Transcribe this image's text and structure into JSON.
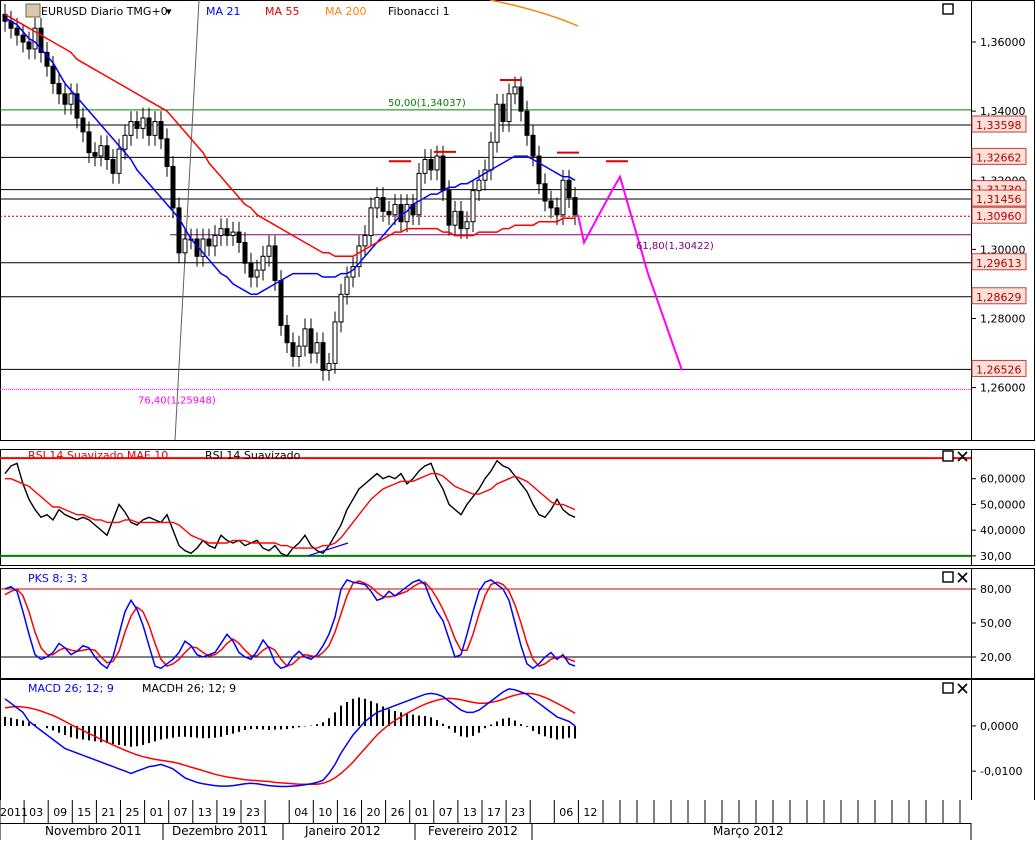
{
  "chart_data": [
    {
      "type": "candlestick",
      "panel": "price",
      "title": "EURUSD Diario TMG+0",
      "title_glyph": "▾",
      "legend": [
        {
          "label": "MA 21",
          "color": "#0000ff"
        },
        {
          "label": "MA 55",
          "color": "#ff0000"
        },
        {
          "label": "MA 200",
          "color": "#ff8000"
        },
        {
          "label": "Fibonacci 1",
          "color": "#000000"
        }
      ],
      "ylim": [
        1.246,
        1.371
      ],
      "yticks": [
        "1,36000",
        "1,34000",
        "1,32000",
        "1,30000",
        "1,28000",
        "1,26000"
      ],
      "ytick_values": [
        1.36,
        1.34,
        1.32,
        1.3,
        1.28,
        1.26
      ],
      "level_labels": [
        {
          "value": 1.33598,
          "label": "1,33598",
          "line": "#000000"
        },
        {
          "value": 1.32662,
          "label": "1,32662",
          "line": "#000000"
        },
        {
          "value": 1.3173,
          "label": "1,31730",
          "line": "#000000"
        },
        {
          "value": 1.31456,
          "label": "1,31456",
          "line": "#000000"
        },
        {
          "value": 1.3096,
          "label": "1,30960",
          "line": "#cc0000"
        },
        {
          "value": 1.29613,
          "label": "1,29613",
          "line": "#000000"
        },
        {
          "value": 1.28629,
          "label": "1,28629",
          "line": "#000000"
        },
        {
          "value": 1.26526,
          "label": "1,26526",
          "line": "#000000"
        }
      ],
      "fibonacci": [
        {
          "label": "50,00(1,34037)",
          "value": 1.34037,
          "color": "#008000"
        },
        {
          "label": "61,80(1,30422)",
          "value": 1.30422,
          "color": "#800080"
        },
        {
          "label": "76,40(1,25948)",
          "value": 1.25948,
          "color": "#ff00ff"
        }
      ],
      "closes": [
        1.366,
        1.364,
        1.362,
        1.36,
        1.358,
        1.364,
        1.357,
        1.353,
        1.348,
        1.345,
        1.342,
        1.345,
        1.338,
        1.334,
        1.328,
        1.327,
        1.33,
        1.326,
        1.322,
        1.329,
        1.333,
        1.337,
        1.335,
        1.338,
        1.333,
        1.337,
        1.332,
        1.324,
        1.312,
        1.299,
        1.303,
        1.303,
        1.298,
        1.303,
        1.301,
        1.304,
        1.306,
        1.304,
        1.305,
        1.302,
        1.296,
        1.292,
        1.294,
        1.298,
        1.301,
        1.291,
        1.278,
        1.273,
        1.269,
        1.272,
        1.277,
        1.27,
        1.273,
        1.265,
        1.267,
        1.279,
        1.287,
        1.292,
        1.295,
        1.301,
        1.304,
        1.312,
        1.315,
        1.311,
        1.31,
        1.313,
        1.308,
        1.313,
        1.31,
        1.322,
        1.326,
        1.323,
        1.327,
        1.317,
        1.307,
        1.311,
        1.306,
        1.308,
        1.317,
        1.32,
        1.323,
        1.331,
        1.342,
        1.337,
        1.345,
        1.347,
        1.34,
        1.333,
        1.327,
        1.319,
        1.314,
        1.312,
        1.31,
        1.32,
        1.315,
        1.31
      ],
      "ma21": [
        1.367,
        1.366,
        1.365,
        1.363,
        1.361,
        1.36,
        1.358,
        1.356,
        1.354,
        1.351,
        1.348,
        1.346,
        1.344,
        1.342,
        1.34,
        1.338,
        1.336,
        1.334,
        1.332,
        1.33,
        1.328,
        1.326,
        1.323,
        1.321,
        1.319,
        1.317,
        1.315,
        1.313,
        1.311,
        1.309,
        1.306,
        1.303,
        1.301,
        1.299,
        1.297,
        1.295,
        1.293,
        1.292,
        1.29,
        1.289,
        1.288,
        1.287,
        1.287,
        1.288,
        1.289,
        1.29,
        1.291,
        1.292,
        1.293,
        1.293,
        1.293,
        1.293,
        1.293,
        1.292,
        1.292,
        1.292,
        1.293,
        1.293,
        1.294,
        1.296,
        1.298,
        1.3,
        1.302,
        1.304,
        1.306,
        1.308,
        1.31,
        1.311,
        1.313,
        1.314,
        1.315,
        1.316,
        1.316,
        1.317,
        1.318,
        1.318,
        1.319,
        1.319,
        1.32,
        1.321,
        1.322,
        1.323,
        1.324,
        1.325,
        1.326,
        1.327,
        1.327,
        1.327,
        1.326,
        1.325,
        1.324,
        1.323,
        1.322,
        1.321,
        1.321,
        1.32
      ],
      "ma55": [
        1.368,
        1.367,
        1.366,
        1.365,
        1.364,
        1.363,
        1.362,
        1.361,
        1.36,
        1.359,
        1.358,
        1.357,
        1.355,
        1.354,
        1.353,
        1.352,
        1.351,
        1.35,
        1.349,
        1.348,
        1.347,
        1.346,
        1.345,
        1.344,
        1.343,
        1.342,
        1.341,
        1.34,
        1.338,
        1.336,
        1.334,
        1.332,
        1.33,
        1.328,
        1.325,
        1.323,
        1.321,
        1.319,
        1.317,
        1.315,
        1.313,
        1.312,
        1.31,
        1.309,
        1.308,
        1.307,
        1.306,
        1.305,
        1.304,
        1.303,
        1.302,
        1.301,
        1.3,
        1.299,
        1.299,
        1.298,
        1.298,
        1.298,
        1.298,
        1.299,
        1.3,
        1.301,
        1.302,
        1.303,
        1.304,
        1.305,
        1.305,
        1.306,
        1.306,
        1.306,
        1.306,
        1.306,
        1.306,
        1.305,
        1.305,
        1.304,
        1.304,
        1.304,
        1.304,
        1.305,
        1.305,
        1.305,
        1.305,
        1.306,
        1.306,
        1.307,
        1.307,
        1.307,
        1.307,
        1.308,
        1.308,
        1.308,
        1.308,
        1.309,
        1.309,
        1.309
      ],
      "projection": [
        1.31,
        1.302,
        1.317,
        1.321,
        1.293,
        1.265
      ]
    },
    {
      "type": "line",
      "panel": "rsi",
      "legend": [
        {
          "label": "RSI 14 Suavizado MAE 10",
          "color": "#ff0000"
        },
        {
          "label": "RSI 14 Suavizado",
          "color": "#000000"
        }
      ],
      "ylim": [
        28,
        70
      ],
      "yticks": [
        "60,0000",
        "50,0000",
        "40,0000",
        "30,00"
      ],
      "ytick_values": [
        60,
        50,
        40,
        30
      ],
      "levels": [
        {
          "value": 68,
          "color": "#ff0000"
        },
        {
          "value": 30,
          "color": "#008000"
        }
      ],
      "rsi": [
        62,
        65,
        66,
        58,
        52,
        48,
        45,
        46,
        44,
        48,
        46,
        45,
        44,
        45,
        44,
        42,
        40,
        38,
        44,
        50,
        47,
        43,
        42,
        44,
        45,
        44,
        43,
        46,
        40,
        34,
        32,
        31,
        33,
        36,
        34,
        33,
        38,
        36,
        35,
        36,
        34,
        35,
        36,
        33,
        32,
        34,
        31,
        30,
        33,
        35,
        38,
        34,
        32,
        31,
        34,
        38,
        42,
        48,
        52,
        56,
        58,
        60,
        62,
        60,
        61,
        60,
        62,
        58,
        60,
        63,
        65,
        66,
        60,
        56,
        50,
        48,
        46,
        50,
        53,
        56,
        60,
        63,
        67,
        65,
        64,
        61,
        58,
        55,
        50,
        46,
        45,
        48,
        52,
        48,
        46,
        45
      ],
      "rsi_ma": [
        60,
        60,
        59,
        58,
        57,
        55,
        53,
        51,
        49,
        49,
        48,
        47,
        46,
        46,
        45,
        44,
        44,
        43,
        43,
        43,
        44,
        44,
        43,
        43,
        43,
        43,
        43,
        43,
        43,
        42,
        40,
        38,
        37,
        36,
        35,
        35,
        35,
        35,
        36,
        36,
        36,
        35,
        35,
        35,
        35,
        35,
        34,
        34,
        33,
        33,
        33,
        33,
        33,
        34,
        34,
        35,
        37,
        40,
        43,
        46,
        49,
        52,
        54,
        56,
        57,
        58,
        59,
        59,
        59,
        60,
        61,
        62,
        62,
        61,
        59,
        57,
        56,
        55,
        54,
        54,
        55,
        56,
        58,
        59,
        60,
        61,
        60,
        59,
        57,
        55,
        53,
        51,
        50,
        50,
        49,
        48
      ]
    },
    {
      "type": "line",
      "panel": "stochastic",
      "legend": [
        {
          "label": "PKS 8; 3; 3",
          "color": "#0000ff"
        }
      ],
      "ylim": [
        5,
        95
      ],
      "yticks": [
        "80,00",
        "50,00",
        "20,00"
      ],
      "ytick_values": [
        80,
        50,
        20
      ],
      "levels": [
        {
          "value": 80,
          "color": "#cc0000"
        },
        {
          "value": 20,
          "color": "#000000"
        }
      ],
      "k": [
        80,
        82,
        78,
        60,
        40,
        22,
        18,
        20,
        24,
        32,
        28,
        22,
        25,
        30,
        28,
        20,
        14,
        10,
        20,
        40,
        60,
        70,
        62,
        48,
        30,
        12,
        10,
        14,
        18,
        24,
        34,
        30,
        22,
        20,
        22,
        24,
        32,
        40,
        34,
        24,
        20,
        18,
        25,
        35,
        28,
        15,
        10,
        12,
        20,
        25,
        20,
        18,
        22,
        30,
        40,
        55,
        80,
        88,
        86,
        85,
        84,
        78,
        70,
        72,
        78,
        74,
        78,
        82,
        86,
        88,
        84,
        70,
        60,
        52,
        36,
        20,
        22,
        40,
        60,
        78,
        86,
        88,
        84,
        80,
        70,
        50,
        30,
        14,
        10,
        14,
        20,
        24,
        18,
        22,
        14,
        12
      ],
      "d": [
        75,
        78,
        80,
        74,
        60,
        42,
        28,
        22,
        22,
        26,
        28,
        26,
        25,
        26,
        27,
        26,
        20,
        15,
        16,
        25,
        42,
        56,
        64,
        60,
        48,
        32,
        18,
        12,
        14,
        18,
        24,
        29,
        28,
        24,
        21,
        22,
        26,
        32,
        36,
        32,
        26,
        21,
        21,
        26,
        29,
        26,
        18,
        12,
        14,
        19,
        22,
        21,
        20,
        24,
        30,
        42,
        58,
        74,
        85,
        87,
        85,
        82,
        77,
        73,
        73,
        74,
        76,
        78,
        82,
        85,
        86,
        80,
        72,
        62,
        50,
        36,
        26,
        26,
        40,
        58,
        74,
        84,
        86,
        84,
        78,
        66,
        50,
        32,
        18,
        12,
        14,
        18,
        20,
        20,
        18,
        16
      ]
    },
    {
      "type": "line",
      "panel": "macd",
      "legend": [
        {
          "label": "MACD 26; 12; 9",
          "color": "#0000ff"
        },
        {
          "label": "MACDH 26; 12; 9",
          "color": "#000000"
        }
      ],
      "ylim": [
        -0.0155,
        0.0095
      ],
      "yticks": [
        "0,0000",
        "-0,0100"
      ],
      "ytick_values": [
        0,
        -0.01
      ],
      "macd": [
        0.006,
        0.005,
        0.004,
        0.003,
        0.001,
        0.0,
        -0.001,
        -0.002,
        -0.003,
        -0.004,
        -0.005,
        -0.0055,
        -0.006,
        -0.0065,
        -0.007,
        -0.0075,
        -0.008,
        -0.0085,
        -0.009,
        -0.0095,
        -0.01,
        -0.0105,
        -0.01,
        -0.0095,
        -0.009,
        -0.0088,
        -0.0085,
        -0.009,
        -0.0095,
        -0.0105,
        -0.0115,
        -0.012,
        -0.0125,
        -0.0128,
        -0.013,
        -0.0132,
        -0.0133,
        -0.0133,
        -0.0132,
        -0.013,
        -0.0128,
        -0.0127,
        -0.0128,
        -0.013,
        -0.0132,
        -0.0133,
        -0.0134,
        -0.0134,
        -0.0133,
        -0.0132,
        -0.013,
        -0.0128,
        -0.0125,
        -0.012,
        -0.0105,
        -0.0085,
        -0.006,
        -0.004,
        -0.002,
        -0.0005,
        0.001,
        0.002,
        0.003,
        0.0035,
        0.004,
        0.0045,
        0.005,
        0.0055,
        0.006,
        0.0065,
        0.007,
        0.0072,
        0.007,
        0.0065,
        0.0055,
        0.0045,
        0.0035,
        0.003,
        0.003,
        0.0035,
        0.0045,
        0.0055,
        0.0065,
        0.0075,
        0.0082,
        0.008,
        0.0075,
        0.007,
        0.006,
        0.005,
        0.004,
        0.003,
        0.002,
        0.0015,
        0.001,
        0.0
      ],
      "signal": [
        0.004,
        0.0042,
        0.0043,
        0.0042,
        0.004,
        0.0037,
        0.0033,
        0.0028,
        0.0023,
        0.0017,
        0.001,
        0.0003,
        -0.0004,
        -0.001,
        -0.0017,
        -0.0023,
        -0.003,
        -0.0036,
        -0.0042,
        -0.0048,
        -0.0054,
        -0.0059,
        -0.0064,
        -0.0068,
        -0.0071,
        -0.0074,
        -0.0076,
        -0.0078,
        -0.008,
        -0.0083,
        -0.0087,
        -0.0091,
        -0.0095,
        -0.0099,
        -0.0103,
        -0.0107,
        -0.011,
        -0.0113,
        -0.0115,
        -0.0117,
        -0.0119,
        -0.012,
        -0.0121,
        -0.0122,
        -0.0123,
        -0.0125,
        -0.0126,
        -0.0127,
        -0.0128,
        -0.0129,
        -0.0129,
        -0.0129,
        -0.0129,
        -0.0127,
        -0.0122,
        -0.0115,
        -0.0105,
        -0.0093,
        -0.008,
        -0.0065,
        -0.005,
        -0.0035,
        -0.002,
        -0.0008,
        0.0003,
        0.0012,
        0.002,
        0.0028,
        0.0035,
        0.0042,
        0.0048,
        0.0053,
        0.0057,
        0.006,
        0.0061,
        0.006,
        0.0058,
        0.0055,
        0.0052,
        0.005,
        0.005,
        0.0052,
        0.0055,
        0.0059,
        0.0064,
        0.0068,
        0.0071,
        0.0072,
        0.0071,
        0.0068,
        0.0063,
        0.0057,
        0.005,
        0.0043,
        0.0036,
        0.0028
      ],
      "hist": [
        0.002,
        0.0018,
        0.0015,
        0.0012,
        0.0008,
        0.0004,
        0.0,
        -0.0005,
        -0.001,
        -0.0015,
        -0.002,
        -0.0025,
        -0.0028,
        -0.003,
        -0.0032,
        -0.0034,
        -0.0036,
        -0.0038,
        -0.004,
        -0.0042,
        -0.0044,
        -0.0046,
        -0.0045,
        -0.0042,
        -0.0038,
        -0.0034,
        -0.003,
        -0.0028,
        -0.0026,
        -0.0024,
        -0.0024,
        -0.0025,
        -0.0026,
        -0.0027,
        -0.0027,
        -0.0026,
        -0.0024,
        -0.002,
        -0.0017,
        -0.0013,
        -0.0009,
        -0.0007,
        -0.0007,
        -0.0008,
        -0.0009,
        -0.0008,
        -0.0008,
        -0.0007,
        -0.0005,
        -0.0003,
        -0.0001,
        0.0001,
        0.0004,
        0.0008,
        0.0017,
        0.003,
        0.0045,
        0.0053,
        0.006,
        0.0063,
        0.006,
        0.0055,
        0.005,
        0.0043,
        0.0037,
        0.0033,
        0.003,
        0.0027,
        0.0025,
        0.0023,
        0.0022,
        0.0019,
        0.0013,
        0.0005,
        -0.0006,
        -0.0015,
        -0.0023,
        -0.0025,
        -0.0022,
        -0.0015,
        -0.0005,
        0.0003,
        0.001,
        0.0016,
        0.0018,
        0.0012,
        0.0004,
        -0.0002,
        -0.0011,
        -0.0018,
        -0.0023,
        -0.0027,
        -0.003,
        -0.0028,
        -0.0026,
        -0.0028
      ]
    }
  ],
  "x_axis": {
    "days": [
      "2011",
      "03",
      "09",
      "15",
      "21",
      "25",
      "01",
      "07",
      "13",
      "19",
      "23",
      "",
      "04",
      "10",
      "16",
      "20",
      "26",
      "01",
      "07",
      "13",
      "17",
      "23",
      "",
      "06",
      "12"
    ],
    "months": [
      "Novembro 2011",
      "Dezembro 2011",
      "Janeiro 2012",
      "Fevereiro 2012",
      "Março 2012"
    ]
  }
}
